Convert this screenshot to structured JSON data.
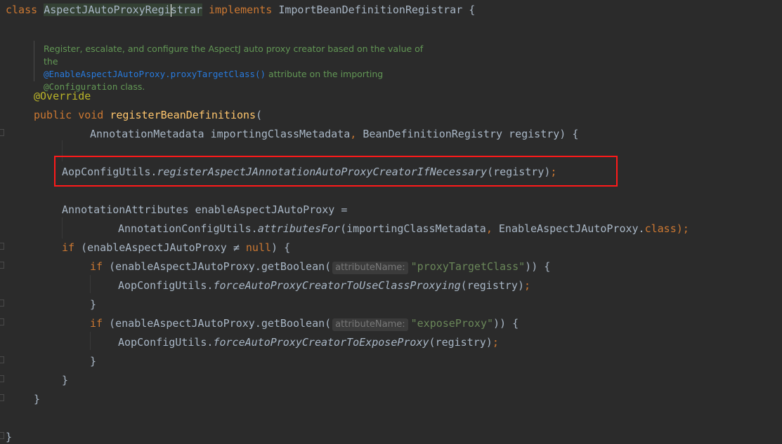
{
  "editor": {
    "line1": {
      "kw_class": "class",
      "name_pre": "AspectJAutoProxyRegi",
      "name_post": "strar",
      "kw_implements": "implements",
      "iface": "ImportBeanDefinitionRegistrar",
      "brace": "{"
    },
    "doc": {
      "line1": "Register, escalate, and configure the AspectJ auto proxy creator based on the value of the",
      "line2_code": "@EnableAspectJAutoProxy.proxyTargetClass()",
      "line2_rest": " attribute on the importing",
      "line3_code": "@Configuration",
      "line3_rest": " class."
    },
    "override": "@Override",
    "method_decl": {
      "kw_public": "public",
      "kw_void": "void",
      "name": "registerBeanDefinitions",
      "paren": "("
    },
    "params": {
      "p1": "AnnotationMetadata importingClassMetadata",
      "comma": ",",
      "p2": " BeanDefinitionRegistry registry) {"
    },
    "highlighted": {
      "cls": "AopConfigUtils.",
      "method": "registerAspectJAnnotationAutoProxyCreatorIfNecessary",
      "args": "(registry)",
      "semi": ";"
    },
    "attrs_decl": "AnnotationAttributes enableAspectJAutoProxy =",
    "attrs_init": {
      "cls": "AnnotationConfigUtils.",
      "method": "attributesFor",
      "args": "(importingClassMetadata",
      "comma": ",",
      "arg2": " EnableAspectJAutoProxy.",
      "kw_class": "class",
      "end": ");"
    },
    "if_null": {
      "kw_if": "if",
      "cond": " (enableAspectJAutoProxy ≠ ",
      "kw_null": "null",
      "end": ") {"
    },
    "if_ptc": {
      "kw_if": "if",
      "call": " (enableAspectJAutoProxy.getBoolean(",
      "hint": "attributeName:",
      "str": "\"proxyTargetClass\"",
      "end": ")) {"
    },
    "force_class": {
      "cls": "AopConfigUtils.",
      "method": "forceAutoProxyCreatorToUseClassProxying",
      "args": "(registry)",
      "semi": ";"
    },
    "close_brace": "}",
    "if_expose": {
      "kw_if": "if",
      "call": " (enableAspectJAutoProxy.getBoolean(",
      "hint": "attributeName:",
      "str": "\"exposeProxy\"",
      "end": ")) {"
    },
    "force_expose": {
      "cls": "AopConfigUtils.",
      "method": "forceAutoProxyCreatorToExposeProxy",
      "args": "(registry)",
      "semi": ";"
    }
  },
  "colors": {
    "background": "#2b2b2b",
    "keyword": "#cc7832",
    "method": "#ffc66d",
    "annotation": "#bbb529",
    "string": "#6a8759",
    "doc": "#629755",
    "highlight_border": "#ff1a1a"
  }
}
